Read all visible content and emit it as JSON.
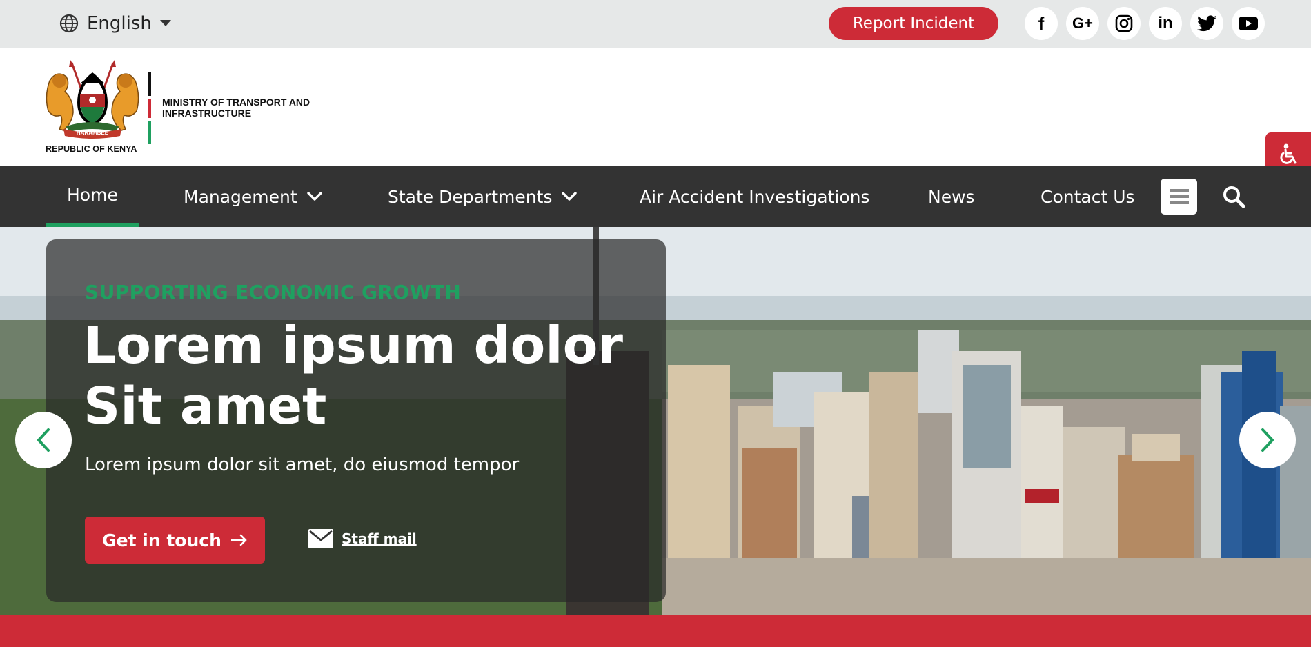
{
  "topbar": {
    "language": "English",
    "report_incident": "Report Incident",
    "social": [
      {
        "name": "facebook-icon",
        "glyph": "f"
      },
      {
        "name": "google-plus-icon",
        "glyph": "G+"
      },
      {
        "name": "instagram-icon",
        "glyph": ""
      },
      {
        "name": "linkedin-icon",
        "glyph": "in"
      },
      {
        "name": "twitter-icon",
        "glyph": ""
      },
      {
        "name": "youtube-icon",
        "glyph": ""
      }
    ]
  },
  "header": {
    "logo_caption": "REPUBLIC OF KENYA",
    "ministry_name": "MINISTRY OF TRANSPORT AND INFRASTRUCTURE",
    "motto": "HARAMBEE"
  },
  "nav": {
    "items": [
      {
        "label": "Home",
        "active": true
      },
      {
        "label": "Management",
        "dropdown": true
      },
      {
        "label": "State Departments",
        "dropdown": true
      },
      {
        "label": "Air Accident Investigations"
      },
      {
        "label": "News"
      },
      {
        "label": "Contact Us"
      }
    ]
  },
  "hero": {
    "eyebrow": "SUPPORTING ECONOMIC GROWTH",
    "headline": "Lorem ipsum dolor Sit amet",
    "subtext": "Lorem ipsum dolor sit amet, do eiusmod tempor",
    "cta": "Get in touch",
    "mail_link": "Staff mail"
  },
  "colors": {
    "brand_red": "#cd2b37",
    "brand_green": "#1fa060",
    "nav_bg": "#333333",
    "topbar_bg": "#e6e8e8"
  }
}
